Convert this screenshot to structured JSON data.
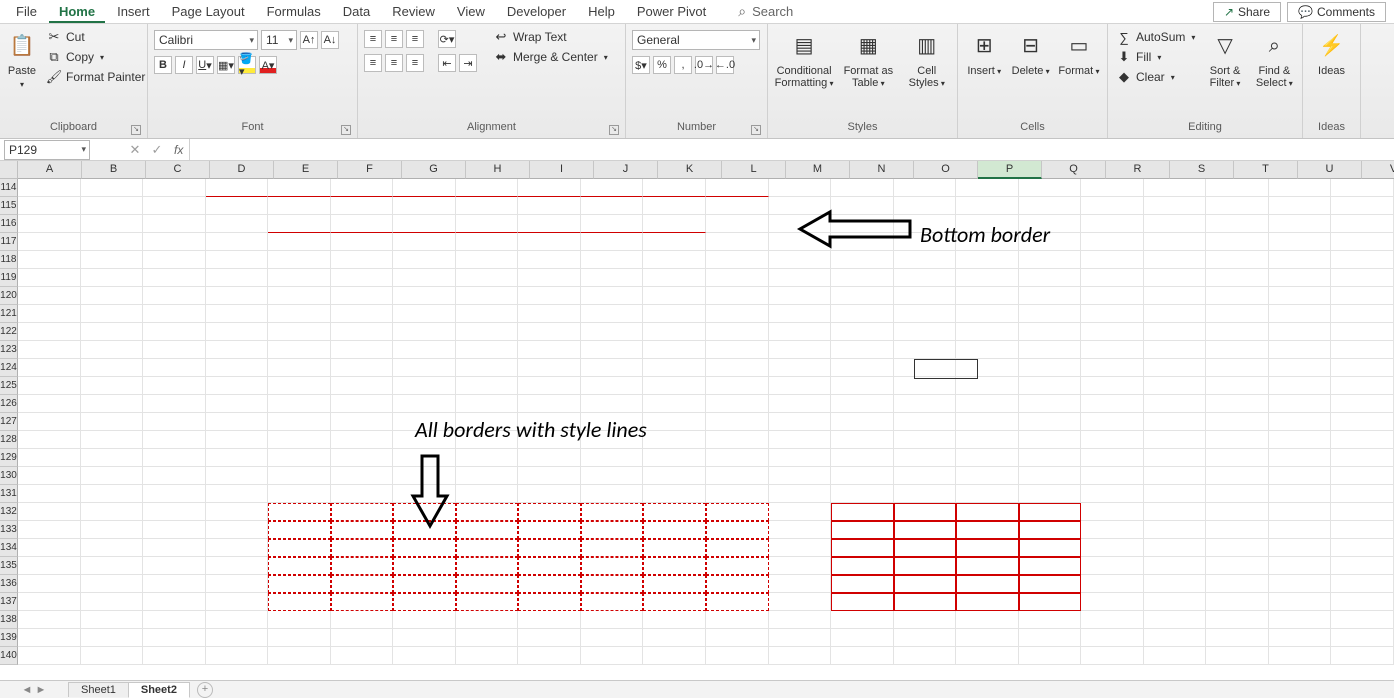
{
  "tabs": [
    "File",
    "Home",
    "Insert",
    "Page Layout",
    "Formulas",
    "Data",
    "Review",
    "View",
    "Developer",
    "Help",
    "Power Pivot"
  ],
  "active_tab": "Home",
  "search_placeholder": "Search",
  "share": "Share",
  "comments": "Comments",
  "clipboard": {
    "paste": "Paste",
    "cut": "Cut",
    "copy": "Copy",
    "fp": "Format Painter",
    "label": "Clipboard"
  },
  "font": {
    "name": "Calibri",
    "size": "11",
    "label": "Font"
  },
  "alignment": {
    "wrap": "Wrap Text",
    "merge": "Merge & Center",
    "label": "Alignment"
  },
  "number": {
    "format": "General",
    "label": "Number"
  },
  "styles": {
    "cf": "Conditional Formatting",
    "fat": "Format as Table",
    "cs": "Cell Styles",
    "label": "Styles"
  },
  "cells": {
    "ins": "Insert",
    "del": "Delete",
    "fmt": "Format",
    "label": "Cells"
  },
  "editing": {
    "sum": "AutoSum",
    "fill": "Fill",
    "clear": "Clear",
    "sort": "Sort & Filter",
    "find": "Find & Select",
    "label": "Editing"
  },
  "ideas": {
    "btn": "Ideas",
    "label": "Ideas"
  },
  "namebox": "P129",
  "cols": [
    "A",
    "B",
    "C",
    "D",
    "E",
    "F",
    "G",
    "H",
    "I",
    "J",
    "K",
    "L",
    "M",
    "N",
    "O",
    "P",
    "Q",
    "R",
    "S",
    "T",
    "U",
    "V"
  ],
  "active_col": "P",
  "rows_start": 114,
  "rows_end": 140,
  "anno1": "Bottom border",
  "anno2": "All borders with style lines",
  "sheets": [
    "Sheet1",
    "Sheet2"
  ],
  "active_sheet": "Sheet2"
}
